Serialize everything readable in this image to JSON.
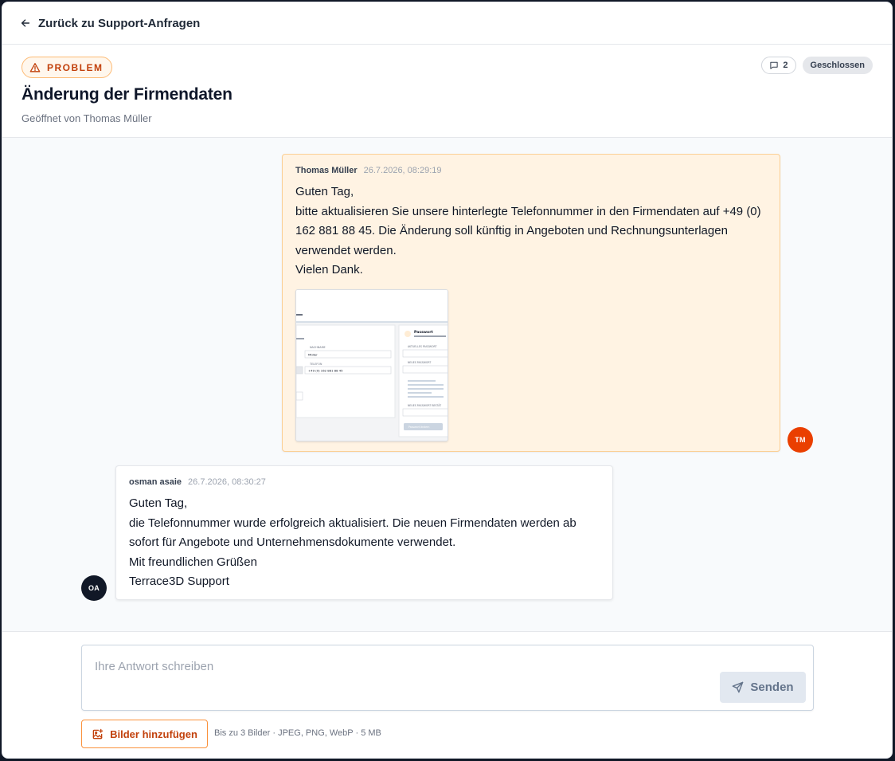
{
  "nav": {
    "back_label": "Zurück zu Support-Anfragen"
  },
  "ticket": {
    "type_label": "PROBLEM",
    "title": "Änderung der Firmendaten",
    "opened_by": "Geöffnet von Thomas Müller",
    "message_count": "2",
    "status": "Geschlossen"
  },
  "messages": [
    {
      "author": "Thomas Müller",
      "timestamp": "26.7.2026, 08:29:19",
      "initials": "TM",
      "lines": [
        "Guten Tag,",
        "bitte aktualisieren Sie unsere hinterlegte Telefonnummer in den Firmendaten auf +49 (0)",
        "162 881 88 45. Die Änderung soll künftig in Angeboten und Rechnungsunterlagen",
        "verwendet werden.",
        "Vielen Dank."
      ],
      "attachment": {
        "fields": {
          "lastname_label": "NACHNAME",
          "lastname_value": "Müller",
          "phone_label": "TELEFON",
          "phone_value": "+49 (0) 162 881 88 45",
          "password_title": "Passwort",
          "current_password_label": "AKTUELLES PASSWORT",
          "new_password_label": "NEUES PASSWORT",
          "confirm_password_label": "NEUES PASSWORT BESTÄT",
          "change_button": "Passwort ändern"
        }
      }
    },
    {
      "author": "osman asaie",
      "timestamp": "26.7.2026, 08:30:27",
      "initials": "OA",
      "lines": [
        "Guten Tag,",
        "die Telefonnummer wurde erfolgreich aktualisiert. Die neuen Firmendaten werden ab",
        "sofort für Angebote und Unternehmensdokumente verwendet.",
        "Mit freundlichen Grüßen",
        "Terrace3D Support"
      ]
    }
  ],
  "composer": {
    "placeholder": "Ihre Antwort schreiben",
    "send_label": "Senden",
    "upload_label": "Bilder hinzufügen",
    "upload_hint": "Bis zu 3 Bilder · JPEG, PNG, WebP · 5 MB"
  },
  "colors": {
    "accent": "#ea580c",
    "user_bubble": "#fff3e3",
    "avatar_user": "#ea3f00",
    "avatar_support": "#111827"
  }
}
